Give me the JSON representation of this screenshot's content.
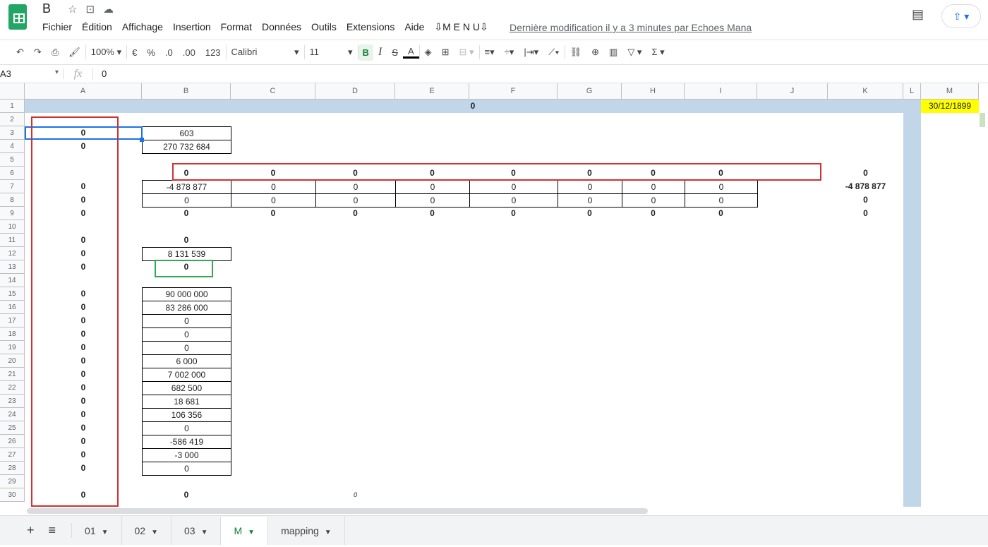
{
  "doc": {
    "title": "B",
    "last_modified": "Dernière modification il y a 3 minutes par Echoes Mana"
  },
  "menu": [
    "Fichier",
    "Édition",
    "Affichage",
    "Insertion",
    "Format",
    "Données",
    "Outils",
    "Extensions",
    "Aide",
    "⇩M E N U⇩"
  ],
  "toolbar": {
    "zoom": "100%",
    "currency": "€",
    "percent": "%",
    "dec_less": ".0",
    "dec_more": ".00",
    "format": "123",
    "font": "Calibri",
    "size": "11",
    "bold": "B",
    "italic": "I",
    "strike": "S",
    "textcolor": "A"
  },
  "formula_bar": {
    "name_box": "A3",
    "fx": "fx",
    "value": "0"
  },
  "columns": [
    "A",
    "B",
    "C",
    "D",
    "E",
    "F",
    "G",
    "H",
    "I",
    "J",
    "K",
    "L",
    "M"
  ],
  "rows": 30,
  "band_value": "0",
  "date_cell": "30/12/1899",
  "cells": [
    {
      "c": 0,
      "r": 3,
      "v": "0",
      "s": "b"
    },
    {
      "c": 1,
      "r": 3,
      "v": "603",
      "s": "bd"
    },
    {
      "c": 0,
      "r": 4,
      "v": "0",
      "s": "b"
    },
    {
      "c": 1,
      "r": 4,
      "v": "270 732 684",
      "s": "bd"
    },
    {
      "c": 1,
      "r": 6,
      "v": "0",
      "s": "b"
    },
    {
      "c": 2,
      "r": 6,
      "v": "0",
      "s": "b"
    },
    {
      "c": 3,
      "r": 6,
      "v": "0",
      "s": "b"
    },
    {
      "c": 4,
      "r": 6,
      "v": "0",
      "s": "b"
    },
    {
      "c": 5,
      "r": 6,
      "v": "0",
      "s": "b"
    },
    {
      "c": 6,
      "r": 6,
      "v": "0",
      "s": "b"
    },
    {
      "c": 7,
      "r": 6,
      "v": "0",
      "s": "b"
    },
    {
      "c": 8,
      "r": 6,
      "v": "0",
      "s": "b"
    },
    {
      "c": 10,
      "r": 6,
      "v": "0",
      "s": "b"
    },
    {
      "c": 0,
      "r": 7,
      "v": "0",
      "s": "b"
    },
    {
      "c": 1,
      "r": 7,
      "v": "-4 878 877",
      "s": "bd"
    },
    {
      "c": 2,
      "r": 7,
      "v": "0",
      "s": "bd"
    },
    {
      "c": 3,
      "r": 7,
      "v": "0",
      "s": "bd"
    },
    {
      "c": 4,
      "r": 7,
      "v": "0",
      "s": "bd"
    },
    {
      "c": 5,
      "r": 7,
      "v": "0",
      "s": "bd"
    },
    {
      "c": 6,
      "r": 7,
      "v": "0",
      "s": "bd"
    },
    {
      "c": 7,
      "r": 7,
      "v": "0",
      "s": "bd"
    },
    {
      "c": 8,
      "r": 7,
      "v": "0",
      "s": "bd"
    },
    {
      "c": 10,
      "r": 7,
      "v": "-4 878 877",
      "s": "b"
    },
    {
      "c": 0,
      "r": 8,
      "v": "0",
      "s": "b"
    },
    {
      "c": 1,
      "r": 8,
      "v": "0",
      "s": "bd"
    },
    {
      "c": 2,
      "r": 8,
      "v": "0",
      "s": "bd"
    },
    {
      "c": 3,
      "r": 8,
      "v": "0",
      "s": "bd"
    },
    {
      "c": 4,
      "r": 8,
      "v": "0",
      "s": "bd"
    },
    {
      "c": 5,
      "r": 8,
      "v": "0",
      "s": "bd"
    },
    {
      "c": 6,
      "r": 8,
      "v": "0",
      "s": "bd"
    },
    {
      "c": 7,
      "r": 8,
      "v": "0",
      "s": "bd"
    },
    {
      "c": 8,
      "r": 8,
      "v": "0",
      "s": "bd"
    },
    {
      "c": 10,
      "r": 8,
      "v": "0",
      "s": "b"
    },
    {
      "c": 0,
      "r": 9,
      "v": "0",
      "s": "b"
    },
    {
      "c": 1,
      "r": 9,
      "v": "0",
      "s": "b"
    },
    {
      "c": 2,
      "r": 9,
      "v": "0",
      "s": "b"
    },
    {
      "c": 3,
      "r": 9,
      "v": "0",
      "s": "b"
    },
    {
      "c": 4,
      "r": 9,
      "v": "0",
      "s": "b"
    },
    {
      "c": 5,
      "r": 9,
      "v": "0",
      "s": "b"
    },
    {
      "c": 6,
      "r": 9,
      "v": "0",
      "s": "b"
    },
    {
      "c": 7,
      "r": 9,
      "v": "0",
      "s": "b"
    },
    {
      "c": 8,
      "r": 9,
      "v": "0",
      "s": "b"
    },
    {
      "c": 10,
      "r": 9,
      "v": "0",
      "s": "b"
    },
    {
      "c": 0,
      "r": 11,
      "v": "0",
      "s": "b"
    },
    {
      "c": 1,
      "r": 11,
      "v": "0",
      "s": "b"
    },
    {
      "c": 0,
      "r": 12,
      "v": "0",
      "s": "b"
    },
    {
      "c": 1,
      "r": 12,
      "v": "8 131 539",
      "s": "bd"
    },
    {
      "c": 0,
      "r": 13,
      "v": "0",
      "s": "b"
    },
    {
      "c": 1,
      "r": 13,
      "v": "0",
      "s": "b"
    },
    {
      "c": 0,
      "r": 15,
      "v": "0",
      "s": "b"
    },
    {
      "c": 1,
      "r": 15,
      "v": "90 000 000",
      "s": "bd"
    },
    {
      "c": 0,
      "r": 16,
      "v": "0",
      "s": "b"
    },
    {
      "c": 1,
      "r": 16,
      "v": "83 286 000",
      "s": "bd"
    },
    {
      "c": 0,
      "r": 17,
      "v": "0",
      "s": "b"
    },
    {
      "c": 1,
      "r": 17,
      "v": "0",
      "s": "bd"
    },
    {
      "c": 0,
      "r": 18,
      "v": "0",
      "s": "b"
    },
    {
      "c": 1,
      "r": 18,
      "v": "0",
      "s": "bd"
    },
    {
      "c": 0,
      "r": 19,
      "v": "0",
      "s": "b"
    },
    {
      "c": 1,
      "r": 19,
      "v": "0",
      "s": "bd"
    },
    {
      "c": 0,
      "r": 20,
      "v": "0",
      "s": "b"
    },
    {
      "c": 1,
      "r": 20,
      "v": "6 000",
      "s": "bd"
    },
    {
      "c": 0,
      "r": 21,
      "v": "0",
      "s": "b"
    },
    {
      "c": 1,
      "r": 21,
      "v": "7 002 000",
      "s": "bd"
    },
    {
      "c": 0,
      "r": 22,
      "v": "0",
      "s": "b"
    },
    {
      "c": 1,
      "r": 22,
      "v": "682 500",
      "s": "bd"
    },
    {
      "c": 0,
      "r": 23,
      "v": "0",
      "s": "b"
    },
    {
      "c": 1,
      "r": 23,
      "v": "18 681",
      "s": "bd"
    },
    {
      "c": 0,
      "r": 24,
      "v": "0",
      "s": "b"
    },
    {
      "c": 1,
      "r": 24,
      "v": "106 356",
      "s": "bd"
    },
    {
      "c": 0,
      "r": 25,
      "v": "0",
      "s": "b"
    },
    {
      "c": 1,
      "r": 25,
      "v": "0",
      "s": "bd"
    },
    {
      "c": 0,
      "r": 26,
      "v": "0",
      "s": "b"
    },
    {
      "c": 1,
      "r": 26,
      "v": "-586 419",
      "s": "bd"
    },
    {
      "c": 0,
      "r": 27,
      "v": "0",
      "s": "b"
    },
    {
      "c": 1,
      "r": 27,
      "v": "-3 000",
      "s": "bd"
    },
    {
      "c": 0,
      "r": 28,
      "v": "0",
      "s": "b"
    },
    {
      "c": 1,
      "r": 28,
      "v": "0",
      "s": "bd"
    },
    {
      "c": 0,
      "r": 30,
      "v": "0",
      "s": "b"
    },
    {
      "c": 1,
      "r": 30,
      "v": "0",
      "s": "b"
    },
    {
      "c": 3,
      "r": 30,
      "v": "0",
      "s": "i"
    }
  ],
  "tabs": [
    {
      "label": "01"
    },
    {
      "label": "02"
    },
    {
      "label": "03"
    },
    {
      "label": "M",
      "active": true
    },
    {
      "label": "mapping"
    }
  ],
  "tab_controls": {
    "add": "+",
    "list": "≡"
  }
}
